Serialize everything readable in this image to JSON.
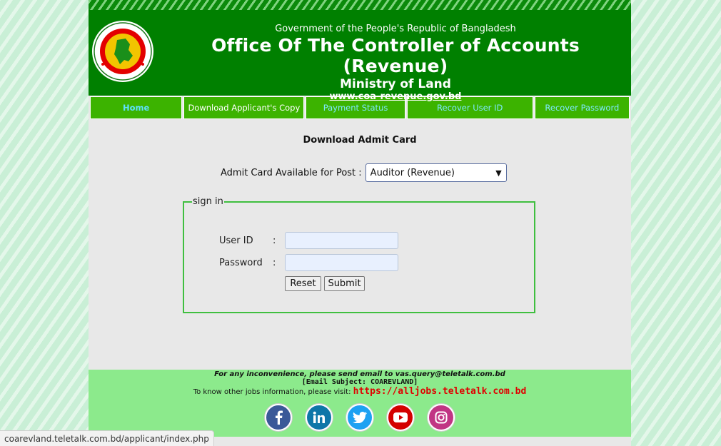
{
  "header": {
    "gov_line": "Government of the People's Republic of Bangladesh",
    "office_title": "Office Of The Controller of Accounts (Revenue)",
    "ministry": "Ministry of Land",
    "website": "www.coa-revenue.gov.bd",
    "seal_icon": "bangladesh-government-seal"
  },
  "nav": {
    "home": "Home",
    "download": "Download Applicant's Copy",
    "payment": "Payment Status",
    "recover_user": "Recover User ID",
    "recover_password": "Recover Password"
  },
  "main": {
    "title": "Download Admit Card",
    "post_label": "Admit Card Available for Post :",
    "post_selected": "Auditor (Revenue)"
  },
  "signin": {
    "legend": "sign in",
    "user_label": "User ID",
    "password_label": "Password",
    "colon": ":",
    "user_value": "",
    "password_value": "",
    "reset": "Reset",
    "submit": "Submit"
  },
  "footer": {
    "line1": "For any inconvenience, please send email to vas.query@teletalk.com.bd",
    "line2": "[Email Subject: COAREVLAND]",
    "line3": "To know other jobs information, please visit:",
    "link": "https://alljobs.teletalk.com.bd",
    "socials": [
      "facebook-icon",
      "linkedin-icon",
      "twitter-icon",
      "youtube-icon",
      "instagram-icon"
    ]
  },
  "statusbar": {
    "url": "coarevland.teletalk.com.bd/applicant/index.php"
  },
  "colors": {
    "header_green": "#008000",
    "nav_green": "#3cb300",
    "footer_green": "#8cea8c",
    "link_red": "#e00000"
  }
}
